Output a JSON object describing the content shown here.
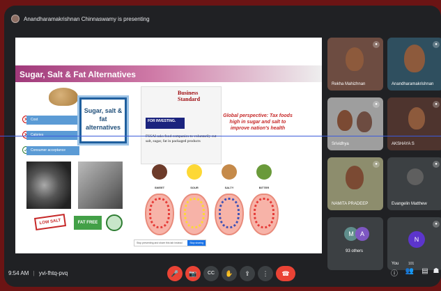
{
  "presenter": {
    "text": "Anandharamakrishnan Chinnaswamy is presenting"
  },
  "slide": {
    "title": "Sugar, Salt & Fat Alternatives",
    "options": [
      "Cost",
      "Calories",
      "Consumer acceptance"
    ],
    "center_box": "Sugar, salt & fat alternatives",
    "badge_low": "LOW SALT",
    "badge_fat": "FAT FREE",
    "news": {
      "brand": "Business Standard",
      "band": "FOR INVESTING.",
      "headline": "FSSAI asks food companies to voluntarily cut salt, sugar, fat in packaged products"
    },
    "perspective": "Global perspective: Tax foods high in sugar and salt to improve nation's health",
    "tastes": [
      "SWEET",
      "SOUR",
      "SALTY",
      "BITTER"
    ],
    "share_prompt": "Stop presenting and share this tab instead",
    "share_button": "Stop sharing"
  },
  "participants": [
    {
      "name": "Rekha Mahizhnan"
    },
    {
      "name": "Anandharamakrishnan"
    },
    {
      "name": "Srividhya"
    },
    {
      "name": "AKSHAYA S"
    },
    {
      "name": "NAMITA PRADEEP"
    },
    {
      "name": "Evangelin Matthew"
    },
    {
      "name": "93 others",
      "avatars": [
        "M",
        "A"
      ]
    },
    {
      "name": "You",
      "avatar": "N"
    }
  ],
  "meeting": {
    "time": "9:54 AM",
    "separator": "|",
    "code": "yvi-fhtq-pvq"
  },
  "toolbar": {
    "mic": "🎤",
    "camera": "📷",
    "captions": "CC",
    "raise_hand": "✋",
    "present": "⇪",
    "more": "⋮",
    "end": "☎"
  },
  "right_controls": {
    "info": "ⓘ",
    "people": "👥",
    "people_count": "101",
    "chat": "▤",
    "activities": "☗"
  },
  "colors": {
    "accent_red": "#ea4335",
    "bg": "#202124",
    "slide_header": "#a0397a"
  }
}
